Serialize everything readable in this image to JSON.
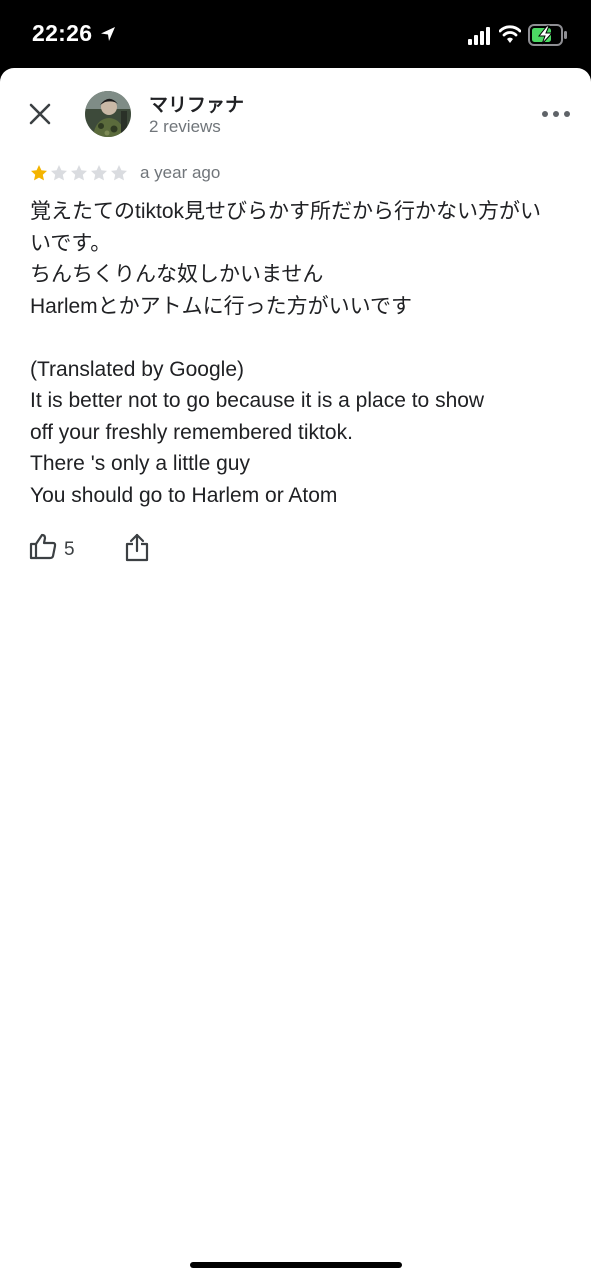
{
  "status_bar": {
    "time": "22:26"
  },
  "reviewer": {
    "name": "マリファナ",
    "review_count": "2 reviews"
  },
  "review": {
    "rating": 1,
    "max_rating": 5,
    "date": "a year ago",
    "original_lines": [
      "覚えたてのtiktok見せびらかす所だから行かない方がい",
      "いです。",
      "ちんちくりんな奴しかいません",
      "Harlemとかアトムに行った方がいいです"
    ],
    "translation_note": "(Translated by Google)",
    "translated_lines": [
      "It is better not to go because it is a place to show",
      "off your freshly remembered tiktok.",
      "There 's only a little guy",
      "You should go to Harlem or Atom"
    ],
    "likes": "5"
  },
  "icons": {
    "location": "location-arrow-icon",
    "signal": "cellular-signal-icon",
    "wifi": "wifi-icon",
    "battery": "battery-charging-icon",
    "close": "close-icon",
    "more": "more-horizontal-icon",
    "like": "thumbs-up-icon",
    "share": "share-icon"
  },
  "colors": {
    "star_filled": "#f4b400",
    "star_empty": "#dadce0",
    "battery": "#4cd964",
    "text_primary": "#202124",
    "text_secondary": "#70757a"
  }
}
